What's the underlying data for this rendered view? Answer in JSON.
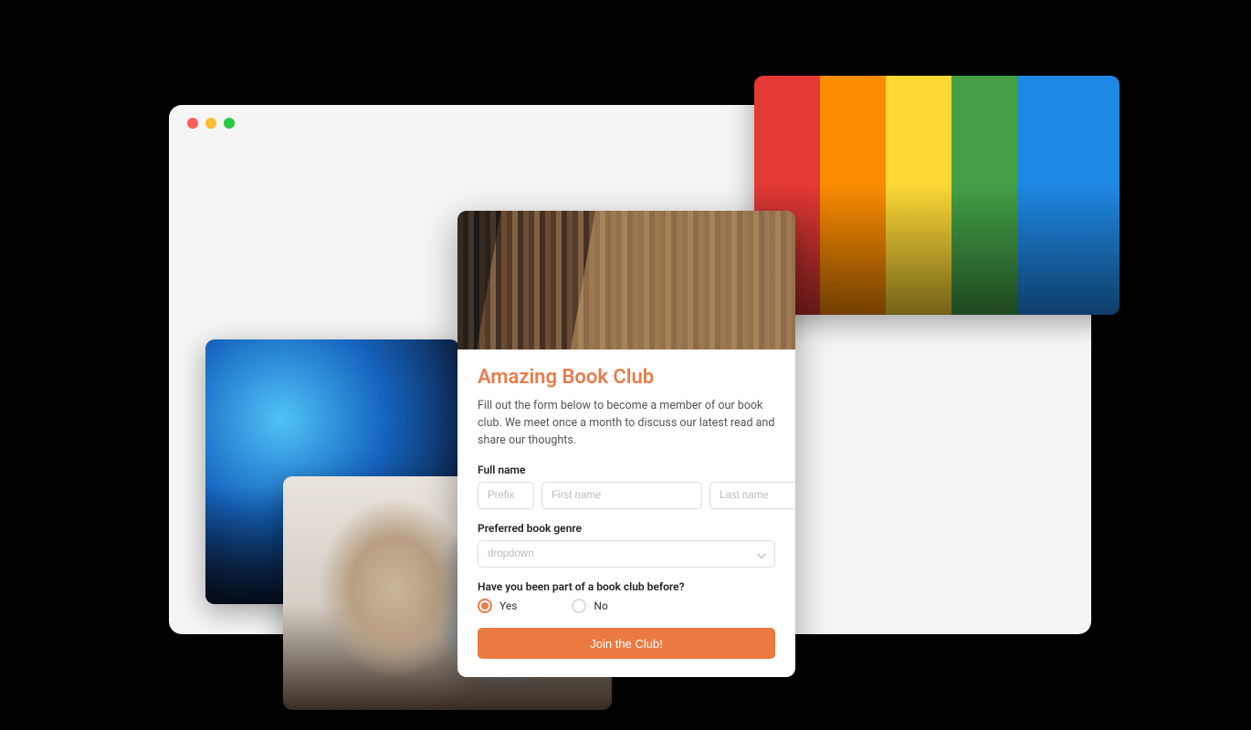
{
  "form": {
    "title": "Amazing Book Club",
    "description": "Fill out the form below to become a member of our book club. We meet once a month to discuss our latest read and share our thoughts.",
    "fullname": {
      "label": "Full name",
      "prefix_placeholder": "Prefix",
      "first_placeholder": "First name",
      "last_placeholder": "Last name"
    },
    "genre": {
      "label": "Preferred book genre",
      "placeholder": "dropdown"
    },
    "prior": {
      "label": "Have you been part of a book club before?",
      "yes": "Yes",
      "no": "No",
      "selected": "yes"
    },
    "submit_label": "Join the Club!"
  }
}
